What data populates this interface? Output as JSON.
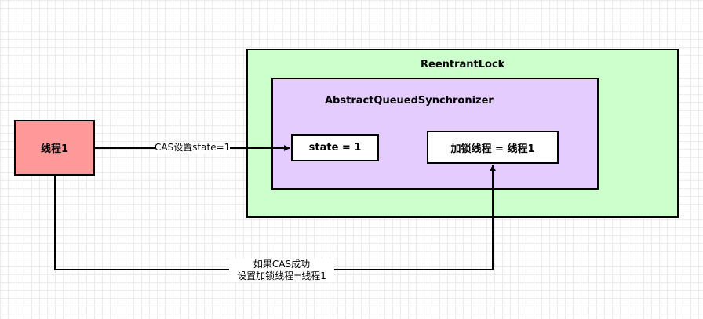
{
  "nodes": {
    "reentrant_lock": {
      "label": "ReentrantLock"
    },
    "aqs": {
      "label": "AbstractQueuedSynchronizer"
    },
    "thread": {
      "label": "线程1"
    },
    "state": {
      "label": "state = 1"
    },
    "owner": {
      "label": "加锁线程 = 线程1"
    }
  },
  "edges": {
    "cas": {
      "label": "CAS设置state=1"
    },
    "owner_set": {
      "line1": "如果CAS成功",
      "line2": "设置加锁线程=线程1"
    }
  },
  "colors": {
    "outer_fill": "#ccffcc",
    "inner_fill": "#e5ccff",
    "thread_fill": "#ff9999",
    "stroke": "#000000"
  }
}
